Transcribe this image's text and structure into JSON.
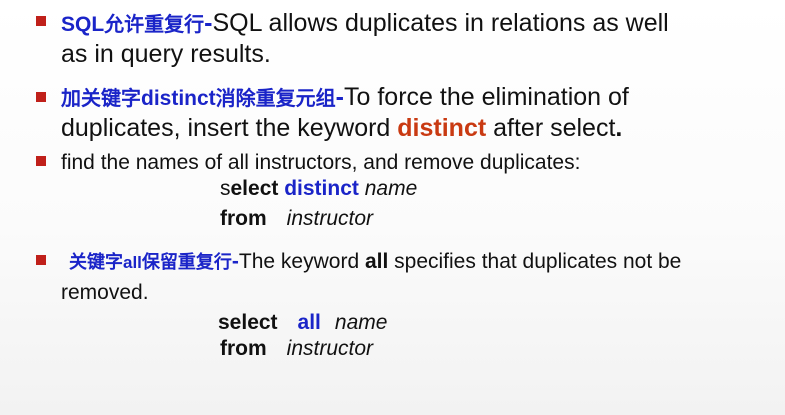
{
  "items": [
    {
      "prefix_bold": "SQL",
      "prefix_cn": "允许重复行",
      "dash": "-",
      "text_line1": "SQL allows duplicates in relations as well",
      "text_line2": "as in query results."
    },
    {
      "prefix_cn1": "加关键字",
      "prefix_bold": "distinct",
      "prefix_cn2": "消除重复元组",
      "dash": "-",
      "text_line1": "To force the elimination of",
      "text_line2_a": "duplicates, insert the keyword ",
      "keyword": "distinct",
      "text_line2_b": " after select",
      "period": "."
    },
    {
      "text": "find the names of all instructors, and remove duplicates:",
      "code": {
        "select_s": "s",
        "select_rest": "elect ",
        "distinct": "distinct",
        "name": "name",
        "from": "from",
        "table": "instructor"
      }
    },
    {
      "prefix_cn1": "关键字",
      "prefix_bold": "all",
      "prefix_cn2": "保留重复行",
      "dash": "-",
      "text_a": "The keyword ",
      "keyword": "all",
      "text_b": " specifies that duplicates not be",
      "text_line2": "removed.",
      "code": {
        "select": "select",
        "all": "all",
        "name": "name",
        "from": "from",
        "table": "instructor"
      }
    }
  ]
}
